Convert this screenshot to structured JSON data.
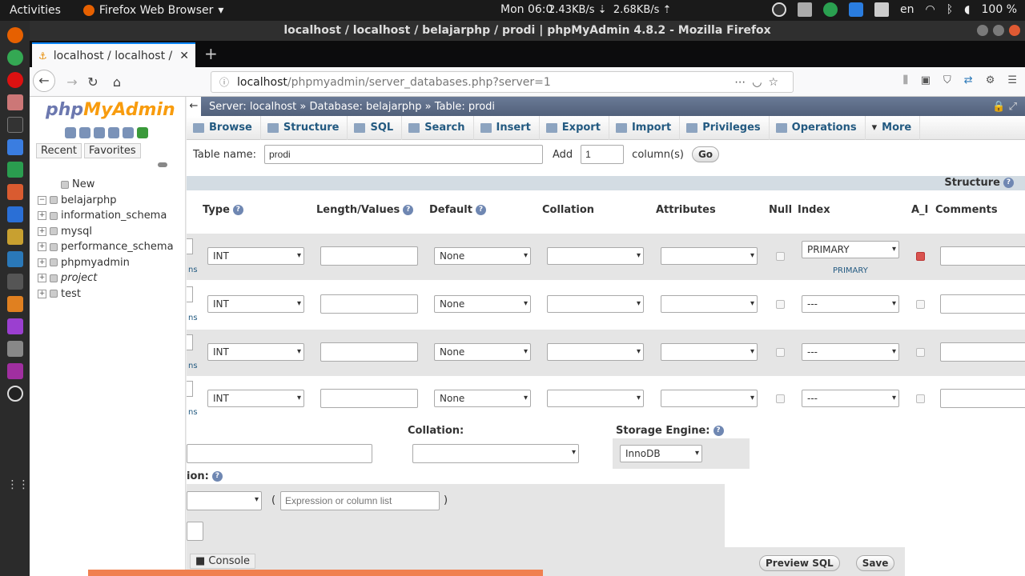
{
  "gnome": {
    "activities": "Activities",
    "app_name": "Firefox Web Browser",
    "clock": "Mon 06:0",
    "net_down": "2.43KB/s ⇣",
    "net_up": "2.68KB/s ⇡",
    "lang": "en",
    "battery": "100 %"
  },
  "window": {
    "title": "localhost / localhost / belajarphp / prodi | phpMyAdmin 4.8.2 - Mozilla Firefox"
  },
  "tab": {
    "title": "localhost / localhost / be"
  },
  "url": {
    "host": "localhost",
    "path": "/phpmyadmin/server_databases.php?server=1"
  },
  "nav": {
    "logo_php": "php",
    "logo_myadmin": "MyAdmin",
    "recent": "Recent",
    "favorites": "Favorites",
    "databases": [
      {
        "name": "New",
        "expander": "",
        "italic": false
      },
      {
        "name": "belajarphp",
        "expander": "−",
        "italic": false
      },
      {
        "name": "information_schema",
        "expander": "+",
        "italic": false
      },
      {
        "name": "mysql",
        "expander": "+",
        "italic": false
      },
      {
        "name": "performance_schema",
        "expander": "+",
        "italic": false
      },
      {
        "name": "phpmyadmin",
        "expander": "+",
        "italic": false
      },
      {
        "name": "project",
        "expander": "+",
        "italic": true
      },
      {
        "name": "test",
        "expander": "+",
        "italic": false
      }
    ]
  },
  "breadcrumb": {
    "server": "Server: localhost",
    "database": "Database: belajarphp",
    "table": "Table: prodi"
  },
  "menu": [
    "Browse",
    "Structure",
    "SQL",
    "Search",
    "Insert",
    "Export",
    "Import",
    "Privileges",
    "Operations",
    "More"
  ],
  "form": {
    "table_name_label": "Table name:",
    "table_name": "prodi",
    "add_label": "Add",
    "add_count": "1",
    "columns_label": "column(s)",
    "go": "Go",
    "structure_label": "Structure"
  },
  "columns": {
    "type": "Type",
    "length": "Length/Values",
    "default": "Default",
    "collation": "Collation",
    "attributes": "Attributes",
    "null": "Null",
    "index": "Index",
    "ai": "A_I",
    "comments": "Comments"
  },
  "rows": [
    {
      "type": "INT",
      "default": "None",
      "index": "PRIMARY",
      "index_link": "PRIMARY",
      "ai": true
    },
    {
      "type": "INT",
      "default": "None",
      "index": "---",
      "index_link": "",
      "ai": false
    },
    {
      "type": "INT",
      "default": "None",
      "index": "---",
      "index_link": "",
      "ai": false
    },
    {
      "type": "INT",
      "default": "None",
      "index": "---",
      "index_link": "",
      "ai": false
    }
  ],
  "row_cutoff": "ns",
  "footer": {
    "collation_label": "Collation:",
    "engine_label": "Storage Engine:",
    "engine": "InnoDB",
    "partition_label": "ion:",
    "expression_placeholder": "Expression or column list",
    "paren_open": "(",
    "paren_close": ")",
    "console": "Console",
    "preview_sql": "Preview SQL",
    "save": "Save"
  }
}
